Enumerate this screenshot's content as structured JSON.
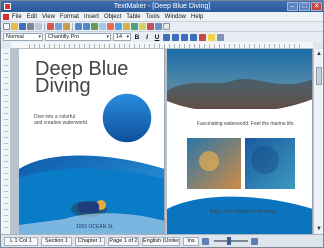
{
  "app": {
    "title": "TextMaker - [Deep Blue Diving]",
    "minimize": "–",
    "maximize": "□",
    "close": "✕"
  },
  "menu": [
    "File",
    "Edit",
    "View",
    "Format",
    "Insert",
    "Object",
    "Table",
    "Tools",
    "Window",
    "Help"
  ],
  "toolbar2": {
    "paragraph_style": "Normal",
    "font": "Chantilly Pro",
    "size": "14",
    "format_labels": [
      "B",
      "I",
      "U"
    ]
  },
  "document": {
    "left_page": {
      "heading_line1": "Deep Blue",
      "heading_line2": "Diving",
      "body_line1": "Dive into a colorful",
      "body_line2": "and creative waterworld.",
      "footer": "1000 OCEAN St."
    },
    "right_page": {
      "caption_top": "Fascinating waterworld. Feel the marine life.",
      "caption_bottom": "Enjoy the colorful coral reefs."
    }
  },
  "statusbar": {
    "position": "L 1 Col 1",
    "section": "Section 1",
    "chapter": "Chapter 1",
    "page": "Page 1 of 2",
    "language": "English (United",
    "mode": "Ins",
    "zoom_value": 0.42
  },
  "colors": {
    "title_bar": "#2b5a9a",
    "ocean_blue": "#1467b8",
    "accent_red": "#d2322d"
  },
  "icons": [
    "app-icon",
    "new-icon",
    "open-icon",
    "save-icon",
    "print-icon",
    "preview-icon",
    "cut-icon",
    "copy-icon",
    "paste-icon",
    "undo-icon",
    "redo-icon",
    "table-icon",
    "picture-icon",
    "zoom-icon"
  ]
}
